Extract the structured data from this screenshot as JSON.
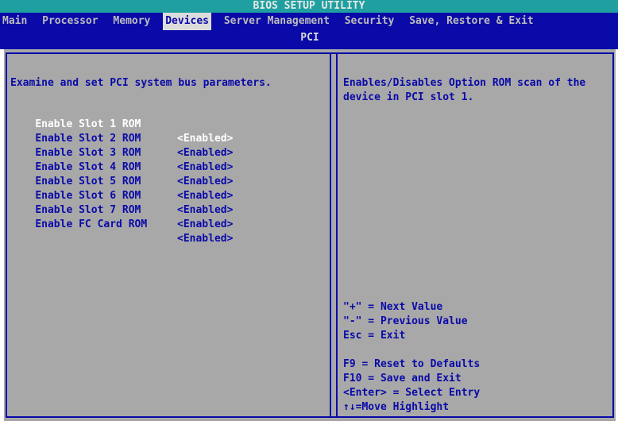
{
  "title": "BIOS SETUP UTILITY",
  "menu": {
    "items": [
      {
        "label": "Main"
      },
      {
        "label": "Processor"
      },
      {
        "label": "Memory"
      },
      {
        "label": "Devices"
      },
      {
        "label": "Server Management"
      },
      {
        "label": "Security"
      },
      {
        "label": "Save, Restore & Exit"
      }
    ],
    "active": "Devices",
    "subtitle": "PCI"
  },
  "page": {
    "description": "Examine and set PCI system bus parameters.",
    "settings": [
      {
        "label": "Enable Slot 1 ROM",
        "value": "<Enabled>",
        "selected": true
      },
      {
        "label": "Enable Slot 2 ROM",
        "value": "<Enabled>"
      },
      {
        "label": "Enable Slot 3 ROM",
        "value": "<Enabled>"
      },
      {
        "label": "Enable Slot 4 ROM",
        "value": "<Enabled>"
      },
      {
        "label": "Enable Slot 5 ROM",
        "value": "<Enabled>"
      },
      {
        "label": "Enable Slot 6 ROM",
        "value": "<Enabled>"
      },
      {
        "label": "Enable Slot 7 ROM",
        "value": "<Enabled>"
      },
      {
        "label": "Enable FC Card ROM",
        "value": "<Enabled>"
      }
    ]
  },
  "help": {
    "lines": [
      "Enables/Disables Option ROM scan of the",
      "device in PCI slot 1."
    ],
    "keys": [
      "\"+\" = Next Value",
      "\"-\" = Previous Value",
      "Esc = Exit",
      "",
      "F9 = Reset to Defaults",
      "F10 = Save and Exit",
      "<Enter> = Select Entry",
      "↑↓=Move Highlight"
    ]
  },
  "colors": {
    "title_bar": "#1f9f9f",
    "menu_bar": "#0a0aa8",
    "panel": "#a8a8a8",
    "selected_text": "#ffffff"
  }
}
